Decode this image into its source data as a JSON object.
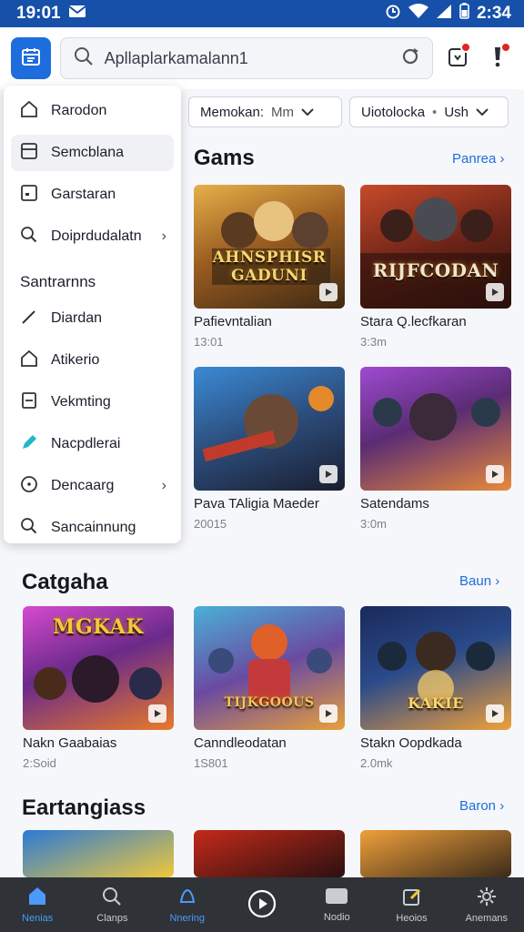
{
  "status": {
    "time_left": "19:01",
    "time_right": "2:34"
  },
  "header": {
    "search_value": "Apllaplarkamalann1"
  },
  "menu": {
    "items_top": [
      "Rarodon",
      "Semcblana",
      "Garstaran",
      "Doiprdudalatn"
    ],
    "section": "Santrarnns",
    "items_bottom": [
      "Diardan",
      "Atikerio",
      "Vekmting",
      "Nacpdlerai",
      "Dencaarg",
      "Sancainnung"
    ]
  },
  "filters": [
    {
      "label": "Memokan:",
      "value": "Mm"
    },
    {
      "label": "Uiotolocka",
      "value": "Ush"
    }
  ],
  "sections": {
    "games": {
      "title": "Gams",
      "link": "Panrea",
      "cards": [
        {
          "name": "Pafievntalian",
          "meta": "13:01",
          "art": "AHNSPHISR GADUNI"
        },
        {
          "name": "Stara Q.lecfkaran",
          "meta": "3:3m",
          "art": "RIJFCODAN"
        },
        {
          "name": "Pava TAligia Maeder",
          "meta": "20015",
          "art": ""
        },
        {
          "name": "Satendams",
          "meta": "3:0m",
          "art": ""
        }
      ]
    },
    "catgaha": {
      "title": "Catgaha",
      "link": "Baun",
      "cards": [
        {
          "name": "Nakn Gaabaias",
          "meta": "2:Soid",
          "art": "MGKAK"
        },
        {
          "name": "Canndleodatan",
          "meta": "1S801",
          "art": "TIJKGOOUS"
        },
        {
          "name": "Stakn Oopdkada",
          "meta": "2.0mk",
          "art": "KAKIE"
        }
      ]
    },
    "eartangiass": {
      "title": "Eartangiass",
      "link": "Baron"
    }
  },
  "bottom_nav": [
    "Nenias",
    "Clanps",
    "Nnering",
    "",
    "Nodio",
    "Heoios",
    "Anemans"
  ],
  "colors": {
    "accent": "#1d6ddd",
    "status_bar": "#1650a9",
    "nav_bg": "#2f3237",
    "badge": "#e2241d"
  }
}
